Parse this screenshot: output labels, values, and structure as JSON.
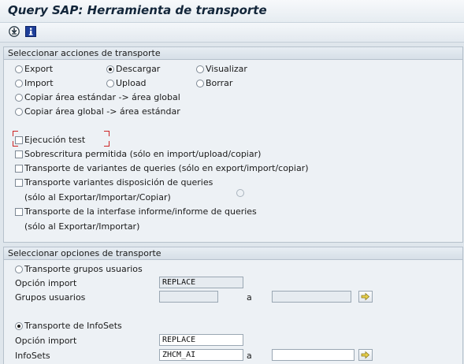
{
  "window": {
    "title": "Query SAP: Herramienta de transporte"
  },
  "toolbar": {
    "icons": [
      "execute-icon",
      "info-icon"
    ]
  },
  "actions_group": {
    "title": "Seleccionar acciones de transporte",
    "radios": {
      "export": "Export",
      "descargar": "Descargar",
      "visualizar": "Visualizar",
      "import": "Import",
      "upload": "Upload",
      "borrar": "Borrar",
      "copy_std_global": "Copiar área estándar -> área global",
      "copy_global_std": "Copiar área global -> área estándar"
    },
    "selected": "descargar",
    "checkboxes": {
      "test": "Ejecución test",
      "overwrite": "Sobrescritura permitida (sólo en import/upload/copiar)",
      "variants": "Transporte de variantes de queries (sólo en export/import/copiar)",
      "layout": "Transporte variantes disposición de queries",
      "layout_note": "(sólo al Exportar/Importar/Copiar)",
      "interface": "Transporte de la interfase informe/informe de queries",
      "interface_note": "(sólo al Exportar/Importar)"
    }
  },
  "options_group": {
    "title": "Seleccionar opciones de transporte",
    "user_groups": {
      "radio_label": "Transporte grupos usuarios",
      "import_option_label": "Opción import",
      "import_option_value": "REPLACE",
      "groups_label": "Grupos usuarios",
      "to_label": "a"
    },
    "infosets": {
      "radio_label": "Transporte de InfoSets",
      "import_option_label": "Opción import",
      "import_option_value": "REPLACE",
      "infosets_label": "InfoSets",
      "infosets_value": "ZHCM_AI",
      "to_label": "a"
    },
    "selected": "infosets"
  }
}
